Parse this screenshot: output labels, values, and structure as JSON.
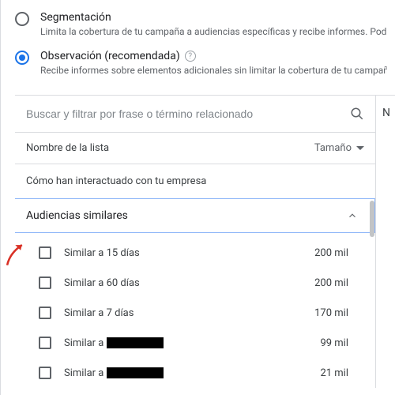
{
  "options": {
    "segmentation": {
      "title": "Segmentación",
      "sub": "Limita la cobertura de tu campaña a audiencias específicas y recibe informes. Podrás"
    },
    "observation": {
      "title": "Observación (recomendada)",
      "sub": "Recibe informes sobre elementos adicionales sin limitar la cobertura de tu campaña."
    }
  },
  "search": {
    "placeholder": "Buscar y filtrar por frase o término relacionado"
  },
  "columns": {
    "name": "Nombre de la lista",
    "size": "Tamaño"
  },
  "section": "Cómo han interactuado con tu empresa",
  "accordion": {
    "title": "Audiencias similares"
  },
  "side_letter": "N",
  "rows": [
    {
      "name": "Similar a 15 días",
      "redacted": false,
      "size": "200 mil"
    },
    {
      "name": "Similar a 60 días",
      "redacted": false,
      "size": "200 mil"
    },
    {
      "name": "Similar a 7 días",
      "redacted": false,
      "size": "170 mil"
    },
    {
      "name": "Similar a",
      "redacted": true,
      "size": "99 mil"
    },
    {
      "name": "Similar a",
      "redacted": true,
      "size": "21 mil"
    }
  ]
}
